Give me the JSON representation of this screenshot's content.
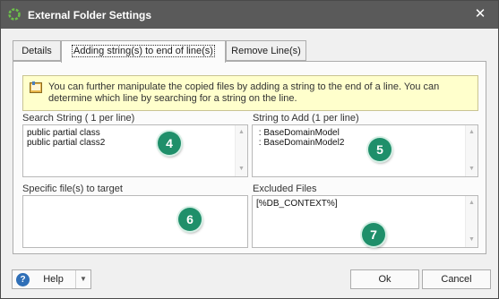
{
  "window": {
    "title": "External Folder Settings",
    "app_icon": "gear-icon",
    "close_label": "✕"
  },
  "tabs": [
    {
      "label": "Details",
      "active": false
    },
    {
      "label": "Adding string(s) to end of line(s)",
      "active": true
    },
    {
      "label": "Remove Line(s)",
      "active": false
    }
  ],
  "info": {
    "icon": "note-icon",
    "text_line1": "You can further manipulate the copied files by adding a string to the end of a line. You can",
    "text_line2": "determine which line by searching for a string on the line."
  },
  "search_string": {
    "label": "Search String ( 1 per line)",
    "lines": [
      "public partial class",
      "public partial class2"
    ],
    "badge": "4"
  },
  "string_to_add": {
    "label": "String to Add (1 per line)",
    "lines": [
      " : BaseDomainModel",
      " : BaseDomainModel2"
    ],
    "badge": "5"
  },
  "specific_files": {
    "label": "Specific file(s) to target",
    "lines": [],
    "badge": "6"
  },
  "excluded_files": {
    "label": "Excluded Files",
    "lines": [
      "[%DB_CONTEXT%]"
    ],
    "badge": "7"
  },
  "footer": {
    "help_label": "Help",
    "help_icon": "question-icon",
    "ok_label": "Ok",
    "cancel_label": "Cancel"
  },
  "colors": {
    "titlebar": "#5a5a5a",
    "badge": "#1f8f6a",
    "info_background": "#ffffcc"
  }
}
